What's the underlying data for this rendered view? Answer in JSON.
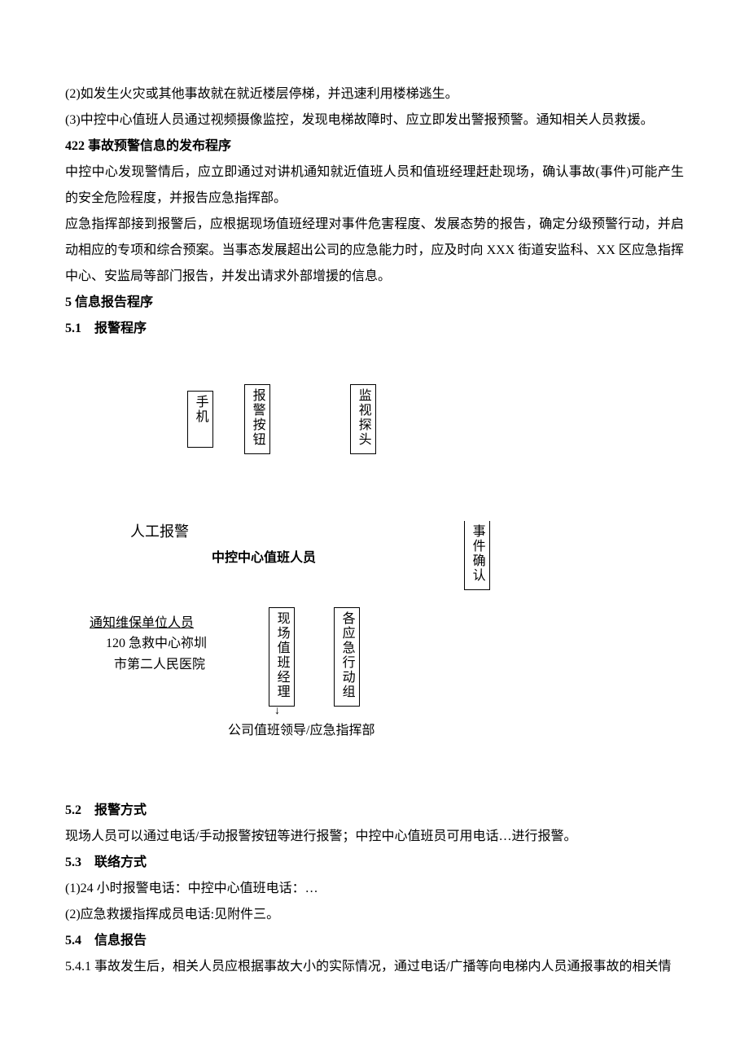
{
  "para1": "(2)如发生火灾或其他事故就在就近楼层停梯，并迅速利用楼梯逃生。",
  "para2": "(3)中控中心值班人员通过视频摄像监控，发现电梯故障时、应立即发出警报预警。通知相关人员救援。",
  "heading422": "422 事故预警信息的发布程序",
  "para3": "中控中心发现警情后，应立即通过对讲机通知就近值班人员和值班经理赶赴现场，确认事故(事件)可能产生的安全危险程度，并报告应急指挥部。",
  "para4": "应急指挥部接到报警后，应根据现场值班经理对事件危害程度、发展态势的报告，确定分级预警行动，并启动相应的专项和综合预案。当事态发展超出公司的应急能力时，应及时向 XXX 街道安监科、XX 区应急指挥中心、安监局等部门报告，并发出请求外部增援的信息。",
  "h5": "5 信息报告程序",
  "h51": "5.1　报警程序",
  "diagram": {
    "phone": "手机",
    "alarmbtn": "报警按钮",
    "camera": "监视探头",
    "manual_alarm": "人工报警",
    "center_staff": "中控中心值班人员",
    "event_confirm": "事件确认",
    "notify_maint": "通知维保单位人员",
    "hospital1": "120 急救中心祢圳",
    "hospital2": "市第二人民医院",
    "onsite_mgr": "现场值班经理",
    "action_groups": "各应急行动组",
    "company_lead": "公司值班领导/应急指挥部"
  },
  "h52": "5.2　报警方式",
  "para52": "现场人员可以通过电话/手动报警按钮等进行报警；中控中心值班员可用电话…进行报警。",
  "h53": "5.3　联络方式",
  "para53a": "(1)24 小时报警电话：中控中心值班电话：…",
  "para53b": "(2)应急救援指挥成员电话:见附件三。",
  "h54": "5.4　信息报告",
  "para541": "5.4.1 事故发生后，相关人员应根据事故大小的实际情况，通过电话/广播等向电梯内人员通报事故的相关情"
}
